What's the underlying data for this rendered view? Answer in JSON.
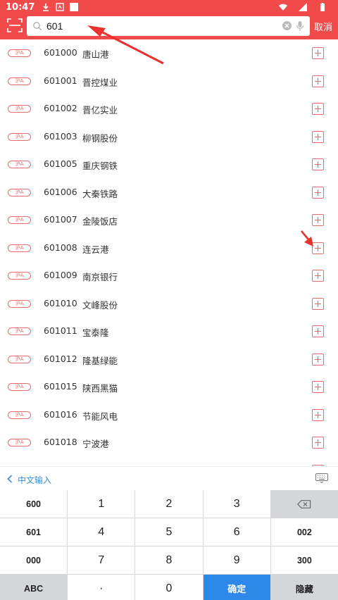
{
  "status": {
    "time": "10:47"
  },
  "search": {
    "query": "601",
    "cancel_label": "取消"
  },
  "stocks": [
    {
      "market": "沪A",
      "code": "601000",
      "name": "唐山港"
    },
    {
      "market": "沪A",
      "code": "601001",
      "name": "晋控煤业"
    },
    {
      "market": "沪A",
      "code": "601002",
      "name": "晋亿实业"
    },
    {
      "market": "沪A",
      "code": "601003",
      "name": "柳钢股份"
    },
    {
      "market": "沪A",
      "code": "601005",
      "name": "重庆钢铁"
    },
    {
      "market": "沪A",
      "code": "601006",
      "name": "大秦铁路"
    },
    {
      "market": "沪A",
      "code": "601007",
      "name": "金陵饭店"
    },
    {
      "market": "沪A",
      "code": "601008",
      "name": "连云港"
    },
    {
      "market": "沪A",
      "code": "601009",
      "name": "南京银行"
    },
    {
      "market": "沪A",
      "code": "601010",
      "name": "文峰股份"
    },
    {
      "market": "沪A",
      "code": "601011",
      "name": "宝泰隆"
    },
    {
      "market": "沪A",
      "code": "601012",
      "name": "隆基绿能"
    },
    {
      "market": "沪A",
      "code": "601015",
      "name": "陕西黑猫"
    },
    {
      "market": "沪A",
      "code": "601016",
      "name": "节能风电"
    },
    {
      "market": "沪A",
      "code": "601018",
      "name": "宁波港"
    }
  ],
  "keyboard": {
    "mode_label": "中文输入",
    "keys": [
      [
        "600",
        "1",
        "2",
        "3",
        "⌫"
      ],
      [
        "601",
        "4",
        "5",
        "6",
        "002"
      ],
      [
        "000",
        "7",
        "8",
        "9",
        "300"
      ],
      [
        "ABC",
        "·",
        "0",
        "确定",
        "隐藏"
      ]
    ]
  },
  "colors": {
    "header": "#f14a4a",
    "accent": "#e36b6b",
    "confirm": "#2d88ea"
  }
}
